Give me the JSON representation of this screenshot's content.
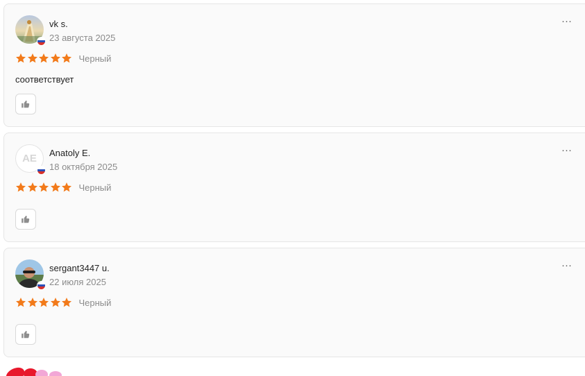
{
  "reviews": [
    {
      "author": "vk s.",
      "date": "23 августа 2025",
      "avatar_type": "photo",
      "avatar_initials": "",
      "country": "russia-flag",
      "rating": 5,
      "variant": "Черный",
      "text": "соответствует",
      "more_label": "···"
    },
    {
      "author": "Anatoly E.",
      "date": "18 октября 2025",
      "avatar_type": "initials",
      "avatar_initials": "AE",
      "country": "russia-flag",
      "rating": 5,
      "variant": "Черный",
      "text": "",
      "more_label": "···"
    },
    {
      "author": "sergant3447 u.",
      "date": "22 июля 2025",
      "avatar_type": "photo",
      "avatar_initials": "",
      "country": "russia-flag",
      "rating": 5,
      "variant": "Черный",
      "text": "",
      "more_label": "···"
    }
  ],
  "colors": {
    "star": "#f27a1a",
    "card_bg": "#fafafa",
    "muted_text": "#8b8b8b"
  },
  "icons": {
    "like": "thumbs-up-icon",
    "more": "more-dots-icon"
  }
}
